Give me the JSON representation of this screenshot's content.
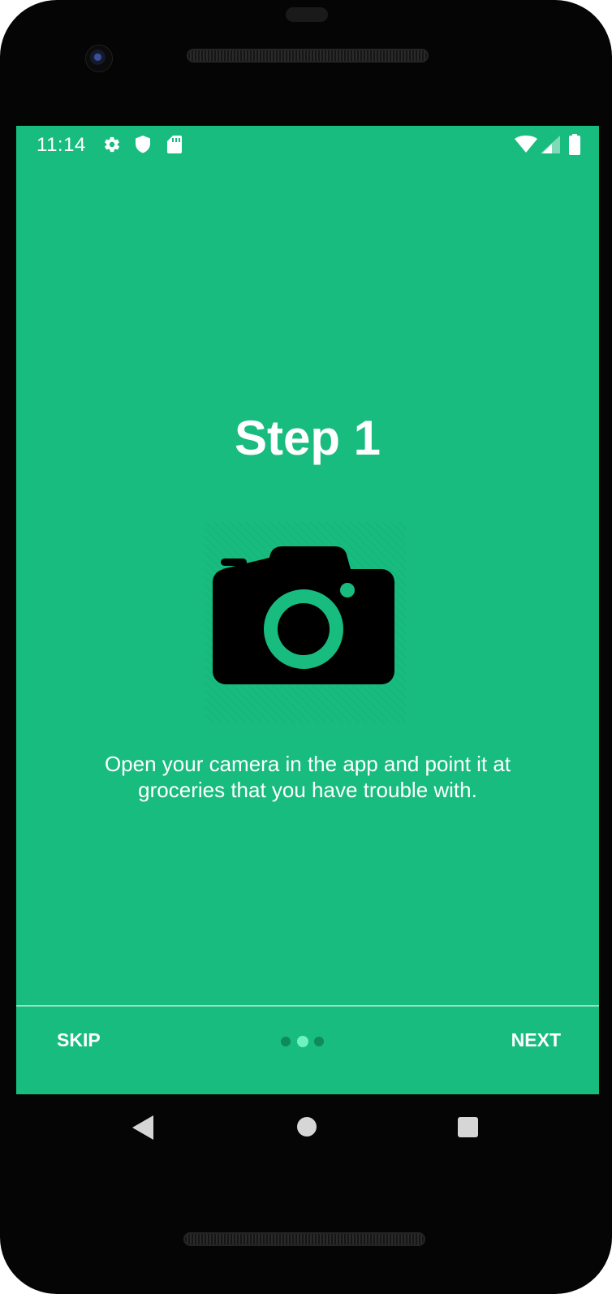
{
  "status_bar": {
    "time": "11:14",
    "left_icons": [
      "gear-icon",
      "shield-icon",
      "sd-card-icon"
    ],
    "right_icons": [
      "wifi-icon",
      "signal-icon",
      "battery-icon"
    ]
  },
  "onboarding": {
    "title": "Step 1",
    "hero_icon": "camera-icon",
    "description": "Open your camera in the app and point it at groceries that you have trouble with.",
    "page_count": 3,
    "current_page": 2
  },
  "footer": {
    "skip_label": "SKIP",
    "next_label": "NEXT"
  },
  "nav_bar": {
    "buttons": [
      "back-icon",
      "home-icon",
      "recent-apps-icon"
    ]
  },
  "colors": {
    "background": "#18bc7f",
    "dot_active": "#6ff2c0",
    "dot_inactive": "#0f8a5c",
    "text": "#ffffff"
  }
}
